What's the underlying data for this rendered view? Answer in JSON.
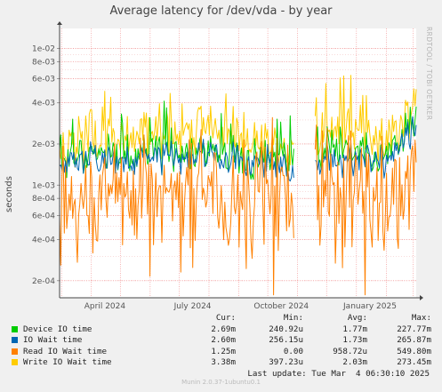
{
  "title": "Average latency for /dev/vda - by year",
  "side_text": "RRDTOOL / TOBI OETIKER",
  "ylabel": "seconds",
  "footer": "Munin 2.0.37-1ubuntu0.1",
  "colors": {
    "background": "#f0f0f0",
    "plot_bg": "#ffffff",
    "device_io": "#00cc00",
    "io_wait": "#0066b3",
    "read_wait": "#ff8000",
    "write_wait": "#ffcc00"
  },
  "legend": {
    "headers": {
      "cur": "Cur:",
      "min": "Min:",
      "avg": "Avg:",
      "max": "Max:"
    },
    "rows": [
      {
        "name": "Device IO time",
        "color": "#00cc00",
        "cur": "2.69m",
        "min": "240.92u",
        "avg": "1.77m",
        "max": "227.77m"
      },
      {
        "name": "IO Wait time",
        "color": "#0066b3",
        "cur": "2.60m",
        "min": "256.15u",
        "avg": "1.73m",
        "max": "265.87m"
      },
      {
        "name": "Read IO Wait time",
        "color": "#ff8000",
        "cur": "1.25m",
        "min": "0.00",
        "avg": "958.72u",
        "max": "549.80m"
      },
      {
        "name": "Write IO Wait time",
        "color": "#ffcc00",
        "cur": "3.38m",
        "min": "397.23u",
        "avg": "2.03m",
        "max": "273.45m"
      }
    ],
    "last_update": "Last update: Tue Mar  4 06:30:10 2025"
  },
  "chart_data": {
    "type": "line",
    "title": "Average latency for /dev/vda - by year",
    "ylabel": "seconds",
    "yscale": "log",
    "ylim": [
      0.00015,
      0.014
    ],
    "xlim": [
      "2024-02-28",
      "2025-03-04"
    ],
    "y_ticks": [
      "2e-04",
      "4e-04",
      "6e-04",
      "8e-04",
      "1e-03",
      "2e-03",
      "4e-03",
      "6e-03",
      "8e-03",
      "1e-02"
    ],
    "x_ticks": [
      "April 2024",
      "July 2024",
      "October 2024",
      "January 2025"
    ],
    "grid": true,
    "gaps": [
      [
        "2024-10-28",
        "2024-11-18"
      ]
    ],
    "series": [
      {
        "name": "Device IO time",
        "color": "#00cc00",
        "x": [
          "2024-03-01",
          "2024-04-01",
          "2024-05-01",
          "2024-06-01",
          "2024-07-01",
          "2024-08-01",
          "2024-09-01",
          "2024-10-01",
          "2024-10-26",
          "2024-11-20",
          "2024-12-15",
          "2025-01-05",
          "2025-02-01",
          "2025-03-03"
        ],
        "values": [
          0.0014,
          0.0017,
          0.0016,
          0.0018,
          0.0017,
          0.0018,
          0.0016,
          0.0016,
          0.0017,
          0.0017,
          0.0018,
          0.0018,
          0.0017,
          0.00269
        ]
      },
      {
        "name": "IO Wait time",
        "color": "#0066b3",
        "x": [
          "2024-03-01",
          "2024-04-01",
          "2024-05-01",
          "2024-06-01",
          "2024-07-01",
          "2024-08-01",
          "2024-09-01",
          "2024-10-01",
          "2024-10-26",
          "2024-11-20",
          "2024-12-15",
          "2025-01-05",
          "2025-02-01",
          "2025-03-03"
        ],
        "values": [
          0.0013,
          0.0016,
          0.0015,
          0.0017,
          0.0016,
          0.0017,
          0.0015,
          0.0015,
          0.0013,
          0.0014,
          0.0015,
          0.0016,
          0.0015,
          0.0026
        ]
      },
      {
        "name": "Read IO Wait time",
        "color": "#ff8000",
        "x": [
          "2024-03-01",
          "2024-04-01",
          "2024-05-01",
          "2024-06-01",
          "2024-07-01",
          "2024-08-01",
          "2024-09-01",
          "2024-10-01",
          "2024-10-26",
          "2024-11-20",
          "2024-12-15",
          "2025-01-05",
          "2025-02-01",
          "2025-03-03"
        ],
        "values": [
          0.0006,
          0.0008,
          0.0009,
          0.0009,
          0.0008,
          0.0009,
          0.0008,
          0.0009,
          0.0007,
          0.0008,
          0.00075,
          0.0008,
          0.0008,
          0.00125
        ]
      },
      {
        "name": "Write IO Wait time",
        "color": "#ffcc00",
        "x": [
          "2024-03-01",
          "2024-04-01",
          "2024-05-01",
          "2024-06-01",
          "2024-07-01",
          "2024-08-01",
          "2024-09-01",
          "2024-10-01",
          "2024-10-26",
          "2024-11-20",
          "2024-12-15",
          "2025-01-05",
          "2025-02-01",
          "2025-03-03"
        ],
        "values": [
          0.0016,
          0.0024,
          0.0022,
          0.0026,
          0.0024,
          0.0027,
          0.0022,
          0.0021,
          0.0018,
          0.0022,
          0.0025,
          0.0026,
          0.0022,
          0.00338
        ]
      }
    ]
  }
}
